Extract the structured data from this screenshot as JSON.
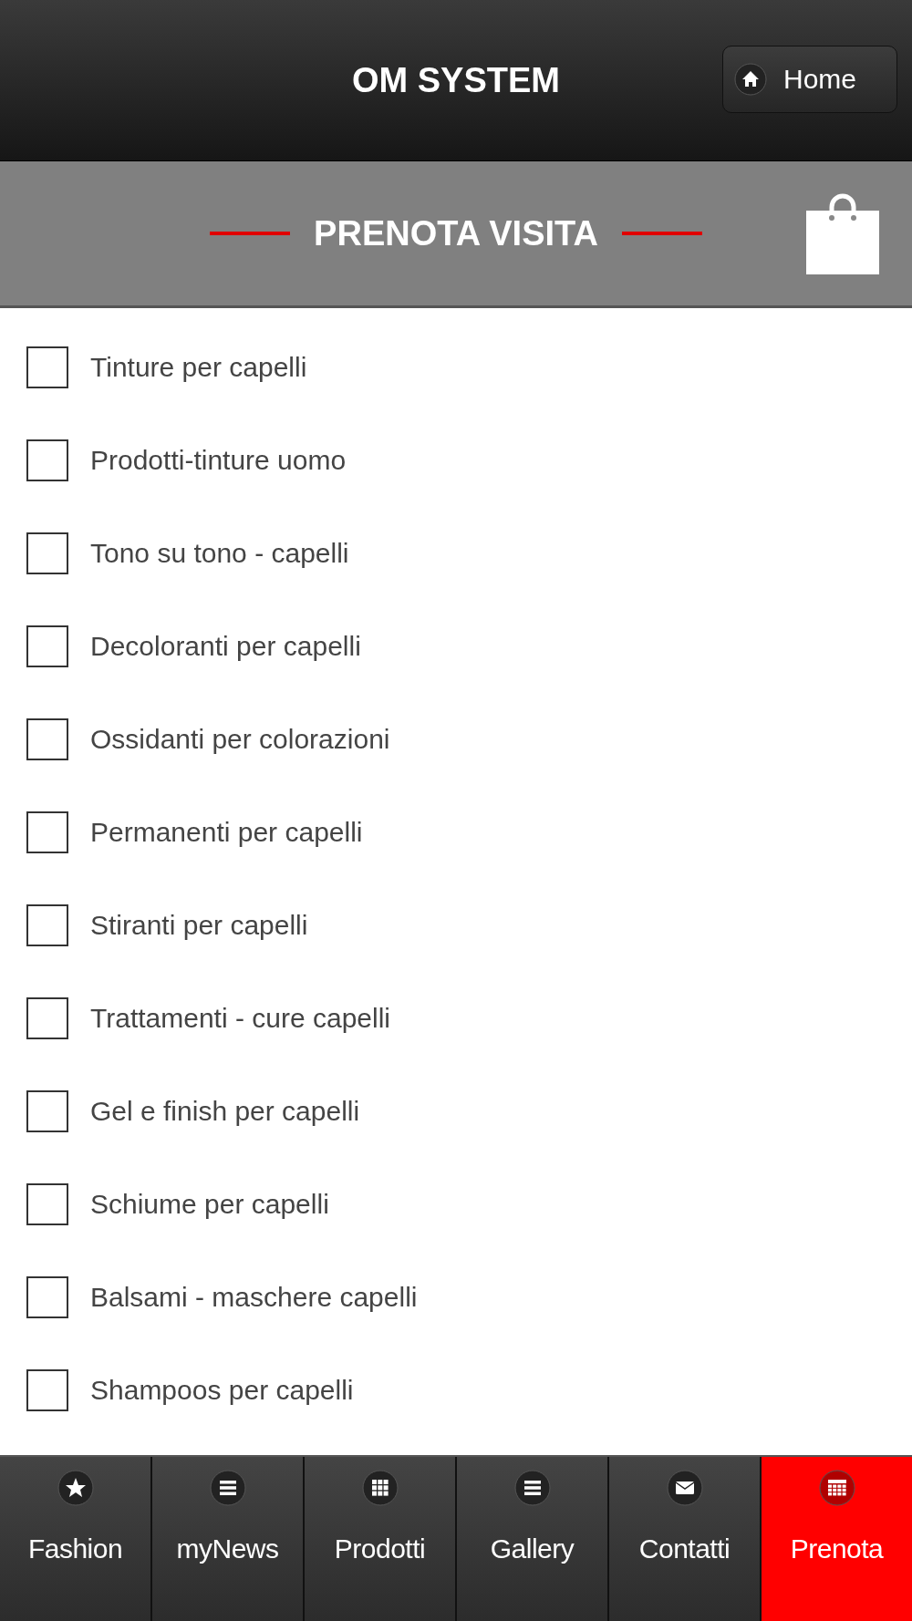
{
  "header": {
    "title": "OM SYSTEM",
    "home_button": "Home"
  },
  "section": {
    "title": "PRENOTA VISITA"
  },
  "services": [
    {
      "label": "Tinture per capelli",
      "checked": false
    },
    {
      "label": "Prodotti-tinture uomo",
      "checked": false
    },
    {
      "label": "Tono su tono - capelli",
      "checked": false
    },
    {
      "label": "Decoloranti per capelli",
      "checked": false
    },
    {
      "label": "Ossidanti per colorazioni",
      "checked": false
    },
    {
      "label": "Permanenti per capelli",
      "checked": false
    },
    {
      "label": "Stiranti per capelli",
      "checked": false
    },
    {
      "label": "Trattamenti - cure capelli",
      "checked": false
    },
    {
      "label": "Gel e finish per capelli",
      "checked": false
    },
    {
      "label": "Schiume per capelli",
      "checked": false
    },
    {
      "label": "Balsami - maschere capelli",
      "checked": false
    },
    {
      "label": "Shampoos per capelli",
      "checked": false
    }
  ],
  "nav": [
    {
      "label": "Fashion",
      "kind": "star",
      "selected": false
    },
    {
      "label": "myNews",
      "kind": "list",
      "selected": false
    },
    {
      "label": "Prodotti",
      "kind": "grid",
      "selected": false
    },
    {
      "label": "Gallery",
      "kind": "list",
      "selected": false
    },
    {
      "label": "Contatti",
      "kind": "mail",
      "selected": false
    },
    {
      "label": "Prenota",
      "kind": "calendar",
      "selected": true
    }
  ]
}
